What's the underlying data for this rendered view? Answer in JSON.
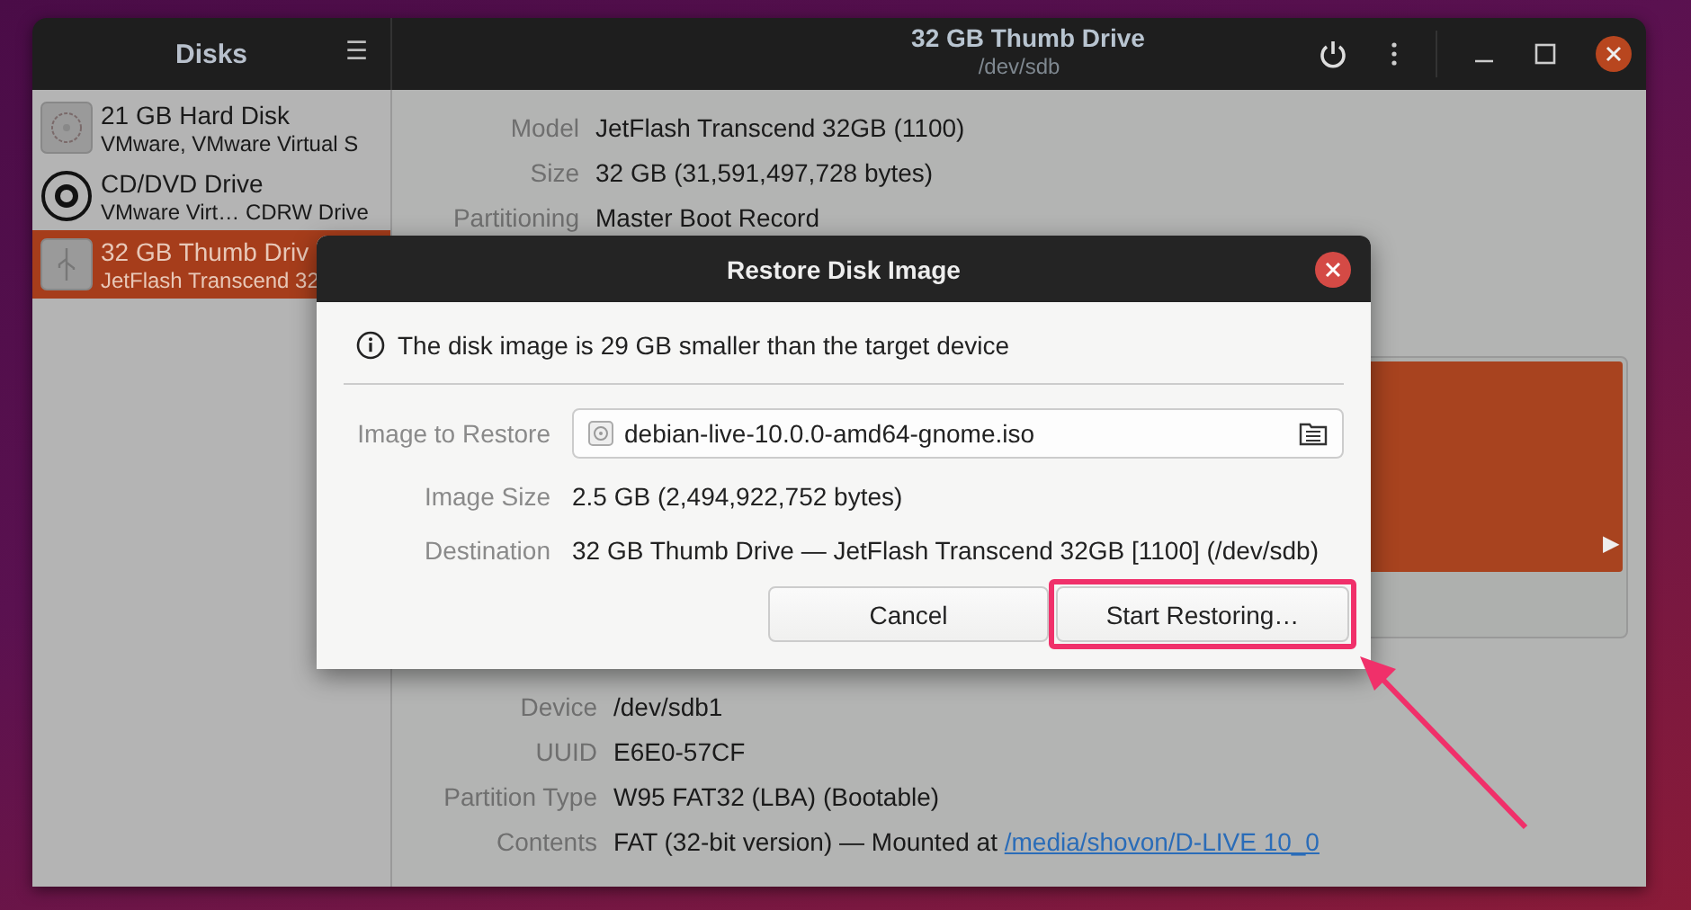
{
  "window": {
    "title": "32 GB Thumb Drive",
    "subtitle": "/dev/sdb"
  },
  "sidebar": {
    "title": "Disks",
    "menu_glyph": "☰",
    "items": [
      {
        "name": "21 GB Hard Disk",
        "detail": "VMware, VMware Virtual S",
        "kind": "hdd",
        "selected": false
      },
      {
        "name": "CD/DVD Drive",
        "detail": "VMware Virt… CDRW Drive",
        "kind": "optical",
        "selected": false
      },
      {
        "name": "32 GB Thumb Driv",
        "detail": "JetFlash Transcend 32",
        "kind": "usb",
        "selected": true
      }
    ]
  },
  "drive_details": [
    {
      "label": "Model",
      "value": "JetFlash Transcend 32GB (1100)"
    },
    {
      "label": "Size",
      "value": "32 GB (31,591,497,728 bytes)"
    },
    {
      "label": "Partitioning",
      "value": "Master Boot Record"
    }
  ],
  "volume_map": {
    "segment_selected": true,
    "arrow": "▶"
  },
  "partition_details": [
    {
      "label": "Device",
      "value": "/dev/sdb1"
    },
    {
      "label": "UUID",
      "value": "E6E0-57CF"
    },
    {
      "label": "Partition Type",
      "value": "W95 FAT32 (LBA) (Bootable)"
    },
    {
      "label": "Contents",
      "value": "FAT (32-bit version) — Mounted at ",
      "link": "/media/shovon/D-LIVE 10_0"
    }
  ],
  "dialog": {
    "title": "Restore Disk Image",
    "info": "The disk image is 29 GB smaller than the target device",
    "image_label": "Image to Restore",
    "image_value": "debian-live-10.0.0-amd64-gnome.iso",
    "rows": [
      {
        "label": "Image Size",
        "value": "2.5 GB (2,494,922,752 bytes)"
      },
      {
        "label": "Destination",
        "value": "32 GB Thumb Drive — JetFlash Transcend 32GB [1100] (/dev/sdb)"
      }
    ],
    "buttons": [
      {
        "label": "Cancel",
        "highlighted": false
      },
      {
        "label": "Start Restoring…",
        "highlighted": true
      }
    ]
  }
}
